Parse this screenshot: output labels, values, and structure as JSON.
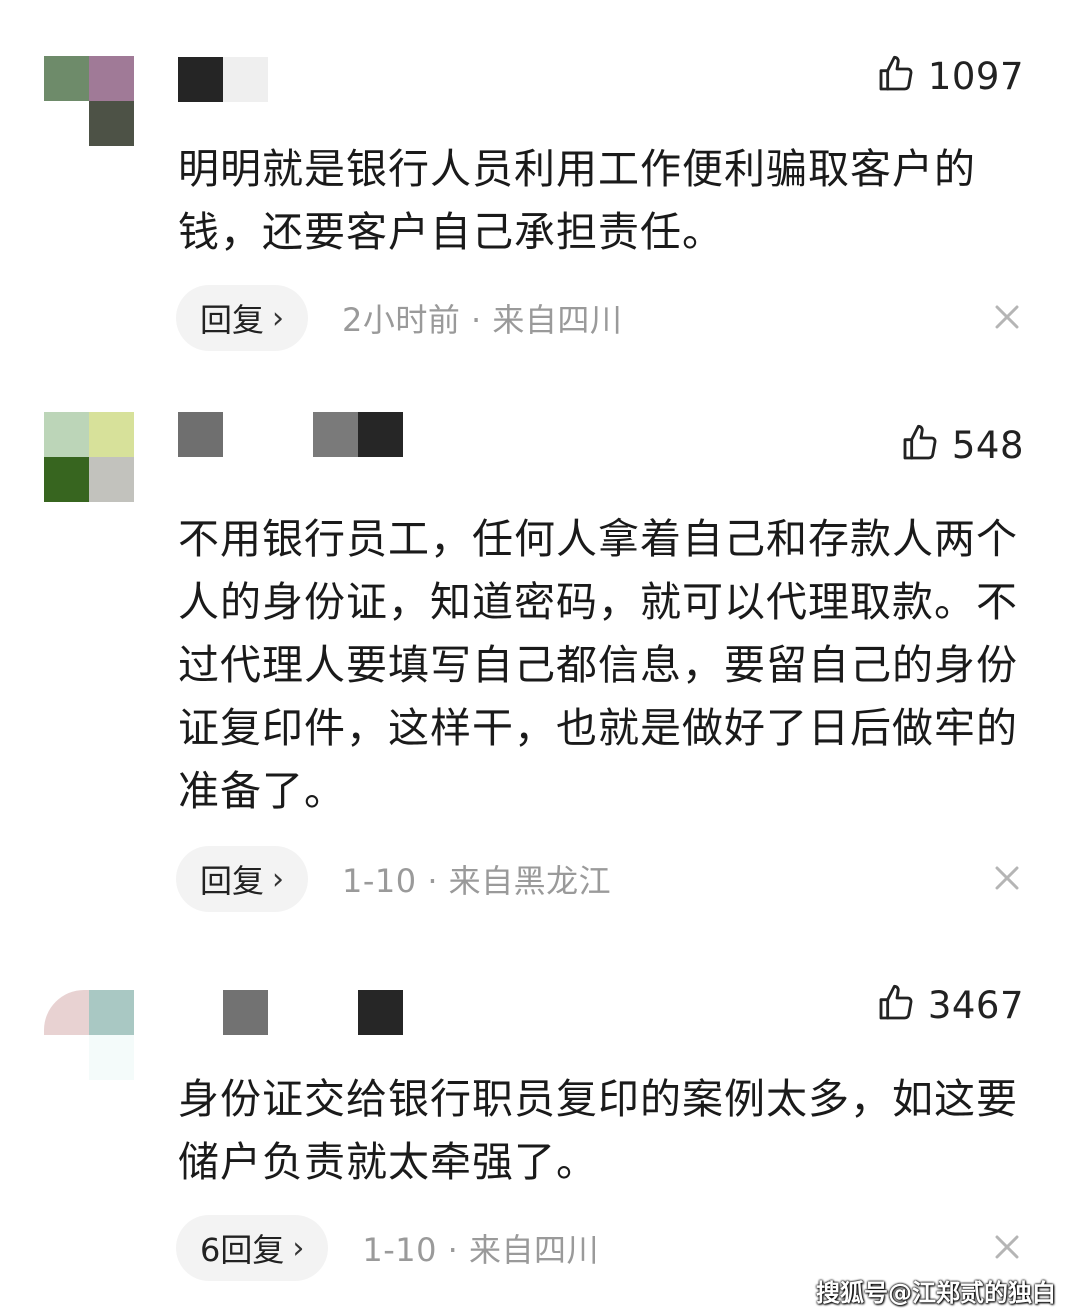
{
  "comments": [
    {
      "likes": "1097",
      "text": "明明就是银行人员利用工作便利骗取客户的钱，还要客户自己承担责任。",
      "reply_label": "回复",
      "meta": "2小时前 · 来自四川"
    },
    {
      "likes": "548",
      "text": "不用银行员工，任何人拿着自己和存款人两个人的身份证，知道密码，就可以代理取款。不过代理人要填写自己都信息，要留自己的身份证复印件，这样干，也就是做好了日后做牢的准备了。",
      "reply_label": "回复",
      "meta": "1-10 · 来自黑龙江"
    },
    {
      "likes": "3467",
      "text": "身份证交给银行职员复印的案例太多，如这要储户负责就太牵强了。",
      "reply_label": "6回复",
      "meta": "1-10 · 来自四川"
    }
  ],
  "icons": {
    "like": "thumbs-up-icon",
    "reply_arrow": "chevron-right-icon",
    "dismiss": "close-icon"
  },
  "watermark": "搜狐号@江郑贰的独白"
}
